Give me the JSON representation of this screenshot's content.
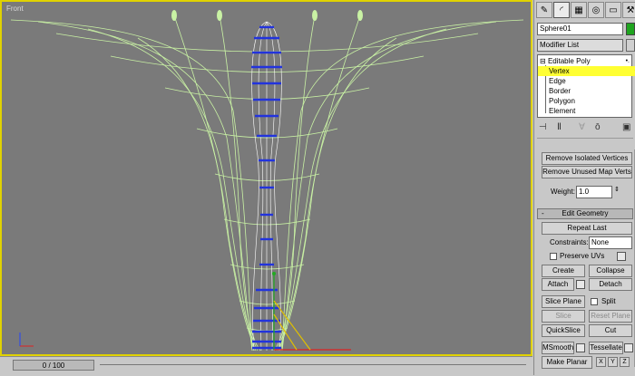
{
  "viewport": {
    "label": "Front"
  },
  "timeline": {
    "frame": "0 / 100"
  },
  "panel": {
    "object_name": "Sphere01",
    "modifier_list": "Modifier List",
    "stack": {
      "root": "Editable Poly",
      "items": [
        "Vertex",
        "Edge",
        "Border",
        "Polygon",
        "Element"
      ],
      "selected": "Vertex"
    },
    "selection": {
      "remove_isolated": "Remove Isolated Vertices",
      "remove_unused_map": "Remove Unused Map Verts",
      "weight_label": "Weight:",
      "weight_value": "1.0"
    },
    "edit_geometry": {
      "title": "Edit Geometry",
      "sign": "-",
      "repeat_last": "Repeat Last",
      "constraints_label": "Constraints:",
      "constraints_value": "None",
      "preserve_uvs": "Preserve UVs",
      "create": "Create",
      "collapse": "Collapse",
      "attach": "Attach",
      "detach": "Detach",
      "slice_plane": "Slice Plane",
      "split": "Split",
      "slice": "Slice",
      "reset_plane": "Reset Plane",
      "quickslice": "QuickSlice",
      "cut": "Cut",
      "msmooth": "MSmooth",
      "tessellate": "Tessellate",
      "make_planar": "Make Planar",
      "x": "X",
      "y": "Y",
      "z": "Z"
    }
  },
  "colors": {
    "viewport_bg": "#7a7a7a",
    "wire_outer": "#c9f2a4",
    "wire_inner": "#ffffff",
    "selected_verts": "#2233dd",
    "viewport_border": "#e0d200",
    "stack_highlight": "#ffff33"
  }
}
